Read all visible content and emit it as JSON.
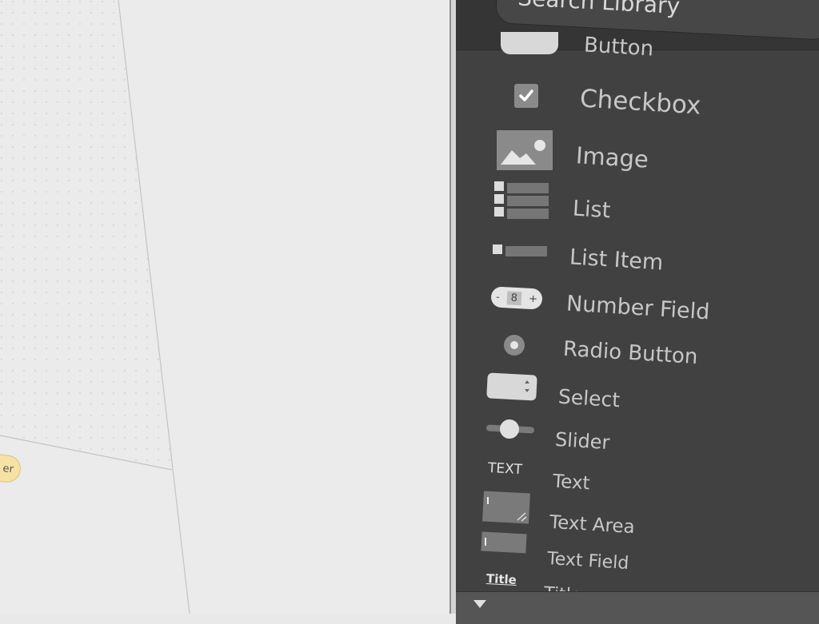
{
  "canvas": {
    "chip_label": "er"
  },
  "library": {
    "search_placeholder": "Search Library",
    "items": [
      {
        "label": "Button",
        "icon": "button-icon"
      },
      {
        "label": "Checkbox",
        "icon": "checkbox-icon"
      },
      {
        "label": "Image",
        "icon": "image-icon"
      },
      {
        "label": "List",
        "icon": "list-icon"
      },
      {
        "label": "List Item",
        "icon": "list-item-icon"
      },
      {
        "label": "Number Field",
        "icon": "number-field-icon",
        "icon_value": "8",
        "icon_minus": "-",
        "icon_plus": "+"
      },
      {
        "label": "Radio Button",
        "icon": "radio-button-icon"
      },
      {
        "label": "Select",
        "icon": "select-icon"
      },
      {
        "label": "Slider",
        "icon": "slider-icon"
      },
      {
        "label": "Text",
        "icon": "text-icon",
        "icon_text": "TEXT"
      },
      {
        "label": "Text Area",
        "icon": "text-area-icon"
      },
      {
        "label": "Text Field",
        "icon": "text-field-icon"
      },
      {
        "label": "Title",
        "icon": "title-icon",
        "icon_text": "Title"
      }
    ]
  },
  "colors": {
    "panel_bg": "#414141",
    "canvas_bg": "#ebebeb",
    "chip_bg": "#f7e2a5"
  }
}
